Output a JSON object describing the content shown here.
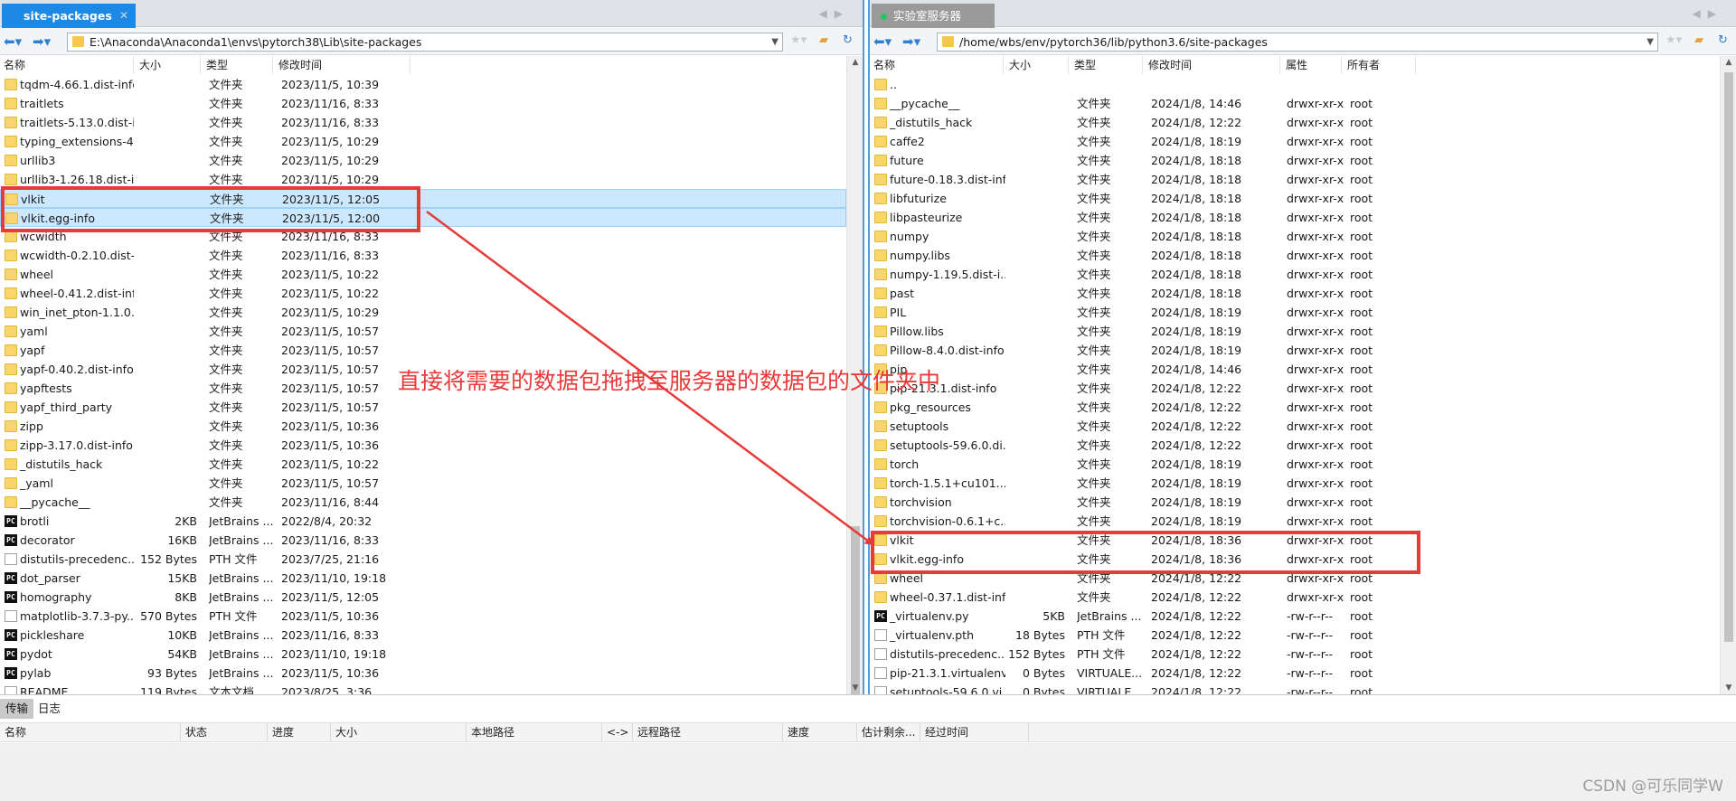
{
  "left": {
    "tab_label": "site-packages",
    "path": "E:\\Anaconda\\Anaconda1\\envs\\pytorch38\\Lib\\site-packages",
    "columns": [
      "名称",
      "大小",
      "类型",
      "修改时间"
    ],
    "rows": [
      {
        "name": "tqdm-4.66.1.dist-info",
        "size": "",
        "type": "文件夹",
        "modified": "2023/11/5, 10:39",
        "icon": "folder-icon"
      },
      {
        "name": "traitlets",
        "size": "",
        "type": "文件夹",
        "modified": "2023/11/16, 8:33",
        "icon": "folder-icon"
      },
      {
        "name": "traitlets-5.13.0.dist-i...",
        "size": "",
        "type": "文件夹",
        "modified": "2023/11/16, 8:33",
        "icon": "folder-icon"
      },
      {
        "name": "typing_extensions-4...",
        "size": "",
        "type": "文件夹",
        "modified": "2023/11/5, 10:29",
        "icon": "folder-icon"
      },
      {
        "name": "urllib3",
        "size": "",
        "type": "文件夹",
        "modified": "2023/11/5, 10:29",
        "icon": "folder-icon"
      },
      {
        "name": "urllib3-1.26.18.dist-i...",
        "size": "",
        "type": "文件夹",
        "modified": "2023/11/5, 10:29",
        "icon": "folder-icon"
      },
      {
        "name": "vlkit",
        "size": "",
        "type": "文件夹",
        "modified": "2023/11/5, 12:05",
        "icon": "folder-icon",
        "selected": true
      },
      {
        "name": "vlkit.egg-info",
        "size": "",
        "type": "文件夹",
        "modified": "2023/11/5, 12:00",
        "icon": "folder-icon",
        "selected": true
      },
      {
        "name": "wcwidth",
        "size": "",
        "type": "文件夹",
        "modified": "2023/11/16, 8:33",
        "icon": "folder-icon"
      },
      {
        "name": "wcwidth-0.2.10.dist-...",
        "size": "",
        "type": "文件夹",
        "modified": "2023/11/16, 8:33",
        "icon": "folder-icon"
      },
      {
        "name": "wheel",
        "size": "",
        "type": "文件夹",
        "modified": "2023/11/5, 10:22",
        "icon": "folder-icon"
      },
      {
        "name": "wheel-0.41.2.dist-info",
        "size": "",
        "type": "文件夹",
        "modified": "2023/11/5, 10:22",
        "icon": "folder-icon"
      },
      {
        "name": "win_inet_pton-1.1.0....",
        "size": "",
        "type": "文件夹",
        "modified": "2023/11/5, 10:29",
        "icon": "folder-icon"
      },
      {
        "name": "yaml",
        "size": "",
        "type": "文件夹",
        "modified": "2023/11/5, 10:57",
        "icon": "folder-icon"
      },
      {
        "name": "yapf",
        "size": "",
        "type": "文件夹",
        "modified": "2023/11/5, 10:57",
        "icon": "folder-icon"
      },
      {
        "name": "yapf-0.40.2.dist-info",
        "size": "",
        "type": "文件夹",
        "modified": "2023/11/5, 10:57",
        "icon": "folder-icon"
      },
      {
        "name": "yapftests",
        "size": "",
        "type": "文件夹",
        "modified": "2023/11/5, 10:57",
        "icon": "folder-icon"
      },
      {
        "name": "yapf_third_party",
        "size": "",
        "type": "文件夹",
        "modified": "2023/11/5, 10:57",
        "icon": "folder-icon"
      },
      {
        "name": "zipp",
        "size": "",
        "type": "文件夹",
        "modified": "2023/11/5, 10:36",
        "icon": "folder-icon"
      },
      {
        "name": "zipp-3.17.0.dist-info",
        "size": "",
        "type": "文件夹",
        "modified": "2023/11/5, 10:36",
        "icon": "folder-icon"
      },
      {
        "name": "_distutils_hack",
        "size": "",
        "type": "文件夹",
        "modified": "2023/11/5, 10:22",
        "icon": "folder-icon"
      },
      {
        "name": "_yaml",
        "size": "",
        "type": "文件夹",
        "modified": "2023/11/5, 10:57",
        "icon": "folder-icon"
      },
      {
        "name": "__pycache__",
        "size": "",
        "type": "文件夹",
        "modified": "2023/11/16, 8:44",
        "icon": "folder-icon"
      },
      {
        "name": "brotli",
        "size": "2KB",
        "type": "JetBrains ...",
        "modified": "2022/8/4, 20:32",
        "icon": "pycharm-file-icon"
      },
      {
        "name": "decorator",
        "size": "16KB",
        "type": "JetBrains ...",
        "modified": "2023/11/16, 8:33",
        "icon": "pycharm-file-icon"
      },
      {
        "name": "distutils-precedenc...",
        "size": "152 Bytes",
        "type": "PTH 文件",
        "modified": "2023/7/25, 21:16",
        "icon": "file-icon"
      },
      {
        "name": "dot_parser",
        "size": "15KB",
        "type": "JetBrains ...",
        "modified": "2023/11/10, 19:18",
        "icon": "pycharm-file-icon"
      },
      {
        "name": "homography",
        "size": "8KB",
        "type": "JetBrains ...",
        "modified": "2023/11/5, 12:05",
        "icon": "pycharm-file-icon"
      },
      {
        "name": "matplotlib-3.7.3-py...",
        "size": "570 Bytes",
        "type": "PTH 文件",
        "modified": "2023/11/5, 10:36",
        "icon": "file-icon"
      },
      {
        "name": "pickleshare",
        "size": "10KB",
        "type": "JetBrains ...",
        "modified": "2023/11/16, 8:33",
        "icon": "pycharm-file-icon"
      },
      {
        "name": "pydot",
        "size": "54KB",
        "type": "JetBrains ...",
        "modified": "2023/11/10, 19:18",
        "icon": "pycharm-file-icon"
      },
      {
        "name": "pylab",
        "size": "93 Bytes",
        "type": "JetBrains ...",
        "modified": "2023/11/5, 10:36",
        "icon": "pycharm-file-icon"
      },
      {
        "name": "README",
        "size": "119 Bytes",
        "type": "文本文档",
        "modified": "2023/8/25, 3:36",
        "icon": "file-icon"
      }
    ]
  },
  "right": {
    "tab_label": "实验室服务器",
    "path": "/home/wbs/env/pytorch36/lib/python3.6/site-packages",
    "columns": [
      "名称",
      "大小",
      "类型",
      "修改时间",
      "属性",
      "所有者"
    ],
    "rows": [
      {
        "name": "..",
        "size": "",
        "type": "",
        "modified": "",
        "perm": "",
        "owner": "",
        "icon": "folder-icon"
      },
      {
        "name": "__pycache__",
        "size": "",
        "type": "文件夹",
        "modified": "2024/1/8, 14:46",
        "perm": "drwxr-xr-x",
        "owner": "root",
        "icon": "folder-icon"
      },
      {
        "name": "_distutils_hack",
        "size": "",
        "type": "文件夹",
        "modified": "2024/1/8, 12:22",
        "perm": "drwxr-xr-x",
        "owner": "root",
        "icon": "folder-icon"
      },
      {
        "name": "caffe2",
        "size": "",
        "type": "文件夹",
        "modified": "2024/1/8, 18:19",
        "perm": "drwxr-xr-x",
        "owner": "root",
        "icon": "folder-icon"
      },
      {
        "name": "future",
        "size": "",
        "type": "文件夹",
        "modified": "2024/1/8, 18:18",
        "perm": "drwxr-xr-x",
        "owner": "root",
        "icon": "folder-icon"
      },
      {
        "name": "future-0.18.3.dist-info",
        "size": "",
        "type": "文件夹",
        "modified": "2024/1/8, 18:18",
        "perm": "drwxr-xr-x",
        "owner": "root",
        "icon": "folder-icon"
      },
      {
        "name": "libfuturize",
        "size": "",
        "type": "文件夹",
        "modified": "2024/1/8, 18:18",
        "perm": "drwxr-xr-x",
        "owner": "root",
        "icon": "folder-icon"
      },
      {
        "name": "libpasteurize",
        "size": "",
        "type": "文件夹",
        "modified": "2024/1/8, 18:18",
        "perm": "drwxr-xr-x",
        "owner": "root",
        "icon": "folder-icon"
      },
      {
        "name": "numpy",
        "size": "",
        "type": "文件夹",
        "modified": "2024/1/8, 18:18",
        "perm": "drwxr-xr-x",
        "owner": "root",
        "icon": "folder-icon"
      },
      {
        "name": "numpy.libs",
        "size": "",
        "type": "文件夹",
        "modified": "2024/1/8, 18:18",
        "perm": "drwxr-xr-x",
        "owner": "root",
        "icon": "folder-icon"
      },
      {
        "name": "numpy-1.19.5.dist-i...",
        "size": "",
        "type": "文件夹",
        "modified": "2024/1/8, 18:18",
        "perm": "drwxr-xr-x",
        "owner": "root",
        "icon": "folder-icon"
      },
      {
        "name": "past",
        "size": "",
        "type": "文件夹",
        "modified": "2024/1/8, 18:18",
        "perm": "drwxr-xr-x",
        "owner": "root",
        "icon": "folder-icon"
      },
      {
        "name": "PIL",
        "size": "",
        "type": "文件夹",
        "modified": "2024/1/8, 18:19",
        "perm": "drwxr-xr-x",
        "owner": "root",
        "icon": "folder-icon"
      },
      {
        "name": "Pillow.libs",
        "size": "",
        "type": "文件夹",
        "modified": "2024/1/8, 18:19",
        "perm": "drwxr-xr-x",
        "owner": "root",
        "icon": "folder-icon"
      },
      {
        "name": "Pillow-8.4.0.dist-info",
        "size": "",
        "type": "文件夹",
        "modified": "2024/1/8, 18:19",
        "perm": "drwxr-xr-x",
        "owner": "root",
        "icon": "folder-icon"
      },
      {
        "name": "pip",
        "size": "",
        "type": "文件夹",
        "modified": "2024/1/8, 14:46",
        "perm": "drwxr-xr-x",
        "owner": "root",
        "icon": "folder-icon"
      },
      {
        "name": "pip-21.3.1.dist-info",
        "size": "",
        "type": "文件夹",
        "modified": "2024/1/8, 12:22",
        "perm": "drwxr-xr-x",
        "owner": "root",
        "icon": "folder-icon"
      },
      {
        "name": "pkg_resources",
        "size": "",
        "type": "文件夹",
        "modified": "2024/1/8, 12:22",
        "perm": "drwxr-xr-x",
        "owner": "root",
        "icon": "folder-icon"
      },
      {
        "name": "setuptools",
        "size": "",
        "type": "文件夹",
        "modified": "2024/1/8, 12:22",
        "perm": "drwxr-xr-x",
        "owner": "root",
        "icon": "folder-icon"
      },
      {
        "name": "setuptools-59.6.0.di...",
        "size": "",
        "type": "文件夹",
        "modified": "2024/1/8, 12:22",
        "perm": "drwxr-xr-x",
        "owner": "root",
        "icon": "folder-icon"
      },
      {
        "name": "torch",
        "size": "",
        "type": "文件夹",
        "modified": "2024/1/8, 18:19",
        "perm": "drwxr-xr-x",
        "owner": "root",
        "icon": "folder-icon"
      },
      {
        "name": "torch-1.5.1+cu101....",
        "size": "",
        "type": "文件夹",
        "modified": "2024/1/8, 18:19",
        "perm": "drwxr-xr-x",
        "owner": "root",
        "icon": "folder-icon"
      },
      {
        "name": "torchvision",
        "size": "",
        "type": "文件夹",
        "modified": "2024/1/8, 18:19",
        "perm": "drwxr-xr-x",
        "owner": "root",
        "icon": "folder-icon"
      },
      {
        "name": "torchvision-0.6.1+c...",
        "size": "",
        "type": "文件夹",
        "modified": "2024/1/8, 18:19",
        "perm": "drwxr-xr-x",
        "owner": "root",
        "icon": "folder-icon"
      },
      {
        "name": "vlkit",
        "size": "",
        "type": "文件夹",
        "modified": "2024/1/8, 18:36",
        "perm": "drwxr-xr-x",
        "owner": "root",
        "icon": "folder-icon"
      },
      {
        "name": "vlkit.egg-info",
        "size": "",
        "type": "文件夹",
        "modified": "2024/1/8, 18:36",
        "perm": "drwxr-xr-x",
        "owner": "root",
        "icon": "folder-icon"
      },
      {
        "name": "wheel",
        "size": "",
        "type": "文件夹",
        "modified": "2024/1/8, 12:22",
        "perm": "drwxr-xr-x",
        "owner": "root",
        "icon": "folder-icon"
      },
      {
        "name": "wheel-0.37.1.dist-info",
        "size": "",
        "type": "文件夹",
        "modified": "2024/1/8, 12:22",
        "perm": "drwxr-xr-x",
        "owner": "root",
        "icon": "folder-icon"
      },
      {
        "name": "_virtualenv.py",
        "size": "5KB",
        "type": "JetBrains ...",
        "modified": "2024/1/8, 12:22",
        "perm": "-rw-r--r--",
        "owner": "root",
        "icon": "pycharm-file-icon"
      },
      {
        "name": "_virtualenv.pth",
        "size": "18 Bytes",
        "type": "PTH 文件",
        "modified": "2024/1/8, 12:22",
        "perm": "-rw-r--r--",
        "owner": "root",
        "icon": "file-icon"
      },
      {
        "name": "distutils-precedenc...",
        "size": "152 Bytes",
        "type": "PTH 文件",
        "modified": "2024/1/8, 12:22",
        "perm": "-rw-r--r--",
        "owner": "root",
        "icon": "file-icon"
      },
      {
        "name": "pip-21.3.1.virtualenv",
        "size": "0 Bytes",
        "type": "VIRTUALE...",
        "modified": "2024/1/8, 12:22",
        "perm": "-rw-r--r--",
        "owner": "root",
        "icon": "file-icon"
      },
      {
        "name": "setuptools-59.6.0.vi...",
        "size": "0 Bytes",
        "type": "VIRTUALE...",
        "modified": "2024/1/8, 12:22",
        "perm": "-rw-r--r--",
        "owner": "root",
        "icon": "file-icon"
      }
    ]
  },
  "transfer": {
    "tabs": [
      "传输",
      "日志"
    ],
    "columns": [
      "名称",
      "状态",
      "进度",
      "大小",
      "本地路径",
      "<->",
      "远程路径",
      "速度",
      "估计剩余...",
      "经过时间"
    ]
  },
  "annotation": {
    "text": "直接将需要的数据包拖拽至服务器的数据包的文件夹中",
    "color": "#e63b3b"
  },
  "watermark": "CSDN @可乐同学W",
  "colors": {
    "active_tab": "#1e88e5",
    "selection": "#cce8ff",
    "folder": "#f8d66d"
  }
}
